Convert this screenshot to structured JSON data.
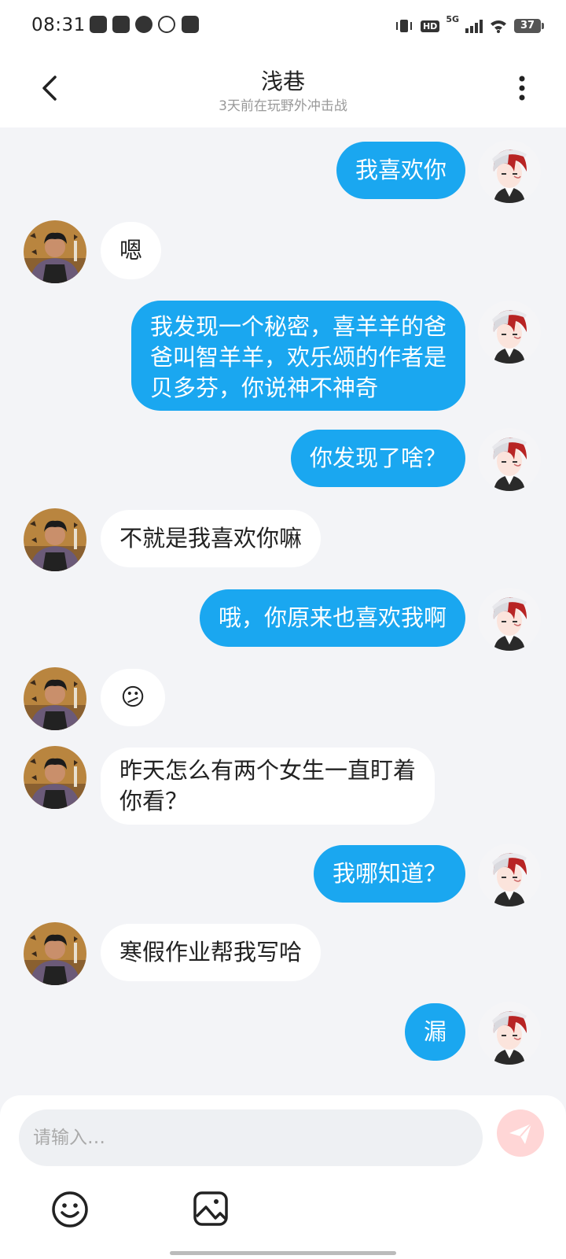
{
  "status_bar": {
    "time": "08:31",
    "network": "5G",
    "hd": "HD",
    "battery": "37",
    "icons": [
      "app-icon",
      "search-app-icon",
      "compass-app-icon",
      "ifly-icon",
      "message-app-icon",
      "vibrate-icon",
      "signal-icon",
      "wifi-icon",
      "battery-icon"
    ]
  },
  "header": {
    "title": "浅巷",
    "subtitle": "3天前在玩野外冲击战",
    "back_icon": "chevron-left-icon",
    "more_icon": "more-vertical-icon"
  },
  "messages": [
    {
      "side": "right",
      "text": "我喜欢你"
    },
    {
      "side": "left",
      "text": "嗯"
    },
    {
      "side": "right",
      "lines": [
        "我发现一个秘密，喜羊羊的爸",
        "爸叫智羊羊，欢乐颂的作者是",
        "贝多芬，你说神不神奇"
      ]
    },
    {
      "side": "right",
      "text": "你发现了啥？"
    },
    {
      "side": "left",
      "text": "不就是我喜欢你嘛"
    },
    {
      "side": "right",
      "text": "哦，你原来也喜欢我啊"
    },
    {
      "side": "left",
      "emoji": "😕"
    },
    {
      "side": "left",
      "lines": [
        "昨天怎么有两个女生一直盯着",
        "你看？"
      ]
    },
    {
      "side": "right",
      "text": "我哪知道？"
    },
    {
      "side": "left",
      "text": "寒假作业帮我写哈"
    },
    {
      "side": "right",
      "text": "漏"
    }
  ],
  "composer": {
    "placeholder": "请输入…",
    "value": "",
    "send_icon": "paper-plane-icon",
    "emoji_icon": "smiley-icon",
    "image_icon": "image-icon"
  },
  "colors": {
    "own_bubble": "#1aa7f0",
    "other_bubble": "#ffffff",
    "background": "#f3f4f7",
    "send_button": "#ffd6d6"
  }
}
